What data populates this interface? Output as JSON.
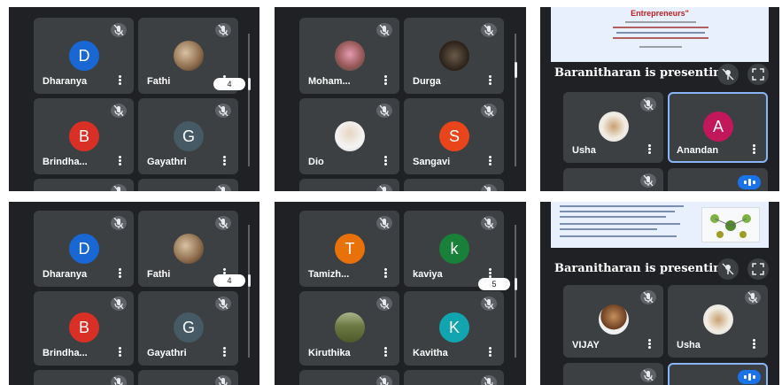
{
  "badges": {
    "p1": "4",
    "p4": "4",
    "p5": "5"
  },
  "colors": {
    "D": "#1967d2",
    "B": "#d93025",
    "G": "#455a64",
    "S": "#e8451b",
    "A": "#c2185b",
    "T": "#e8710a",
    "k": "#188038",
    "K": "#12a4af"
  },
  "panel1": {
    "t1": "Dharanya",
    "t1_letter": "D",
    "t2": "Fathi",
    "t3": "Brindha...",
    "t3_letter": "B",
    "t4": "Gayathri",
    "t4_letter": "G"
  },
  "panel2": {
    "t1": "Moham...",
    "t2": "Durga",
    "t3": "Dio",
    "t4": "Sangavi",
    "t4_letter": "S"
  },
  "panel3": {
    "slide_title": "Entrepreneurs\"",
    "presenting": "Baranitharan is presenting",
    "t1": "Usha",
    "t2": "Anandan",
    "t2_letter": "A"
  },
  "panel4": {
    "t1": "Dharanya",
    "t1_letter": "D",
    "t2": "Fathi",
    "t3": "Brindha...",
    "t3_letter": "B",
    "t4": "Gayathri",
    "t4_letter": "G"
  },
  "panel5": {
    "t1": "Tamizh...",
    "t1_letter": "T",
    "t2": "kaviya",
    "t2_letter": "k",
    "t3": "Kiruthika",
    "t4": "Kavitha",
    "t4_letter": "K"
  },
  "panel6": {
    "presenting": "Baranitharan is presenting",
    "t1": "VIJAY",
    "t2": "Usha"
  }
}
